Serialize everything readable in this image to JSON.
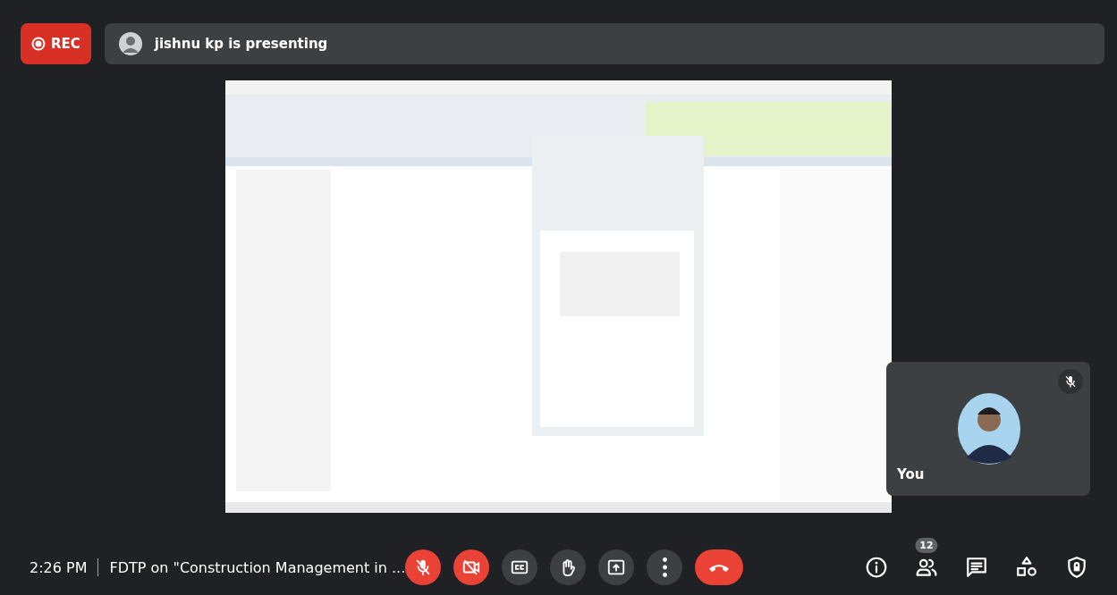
{
  "recording": {
    "label": "REC"
  },
  "presenter": {
    "text": "jishnu kp is presenting"
  },
  "self_tile": {
    "label": "You",
    "muted": true
  },
  "meeting": {
    "time": "2:26 PM",
    "title": "FDTP on \"Construction Management in ..."
  },
  "controls": [
    {
      "kind": "mic",
      "off": true
    },
    {
      "kind": "camera",
      "off": true
    },
    {
      "kind": "captions"
    },
    {
      "kind": "hand"
    },
    {
      "kind": "present"
    },
    {
      "kind": "more"
    },
    {
      "kind": "leave"
    }
  ],
  "side_controls": [
    {
      "kind": "info"
    },
    {
      "kind": "people",
      "badge": "12"
    },
    {
      "kind": "chat"
    },
    {
      "kind": "activities"
    },
    {
      "kind": "safety"
    }
  ]
}
